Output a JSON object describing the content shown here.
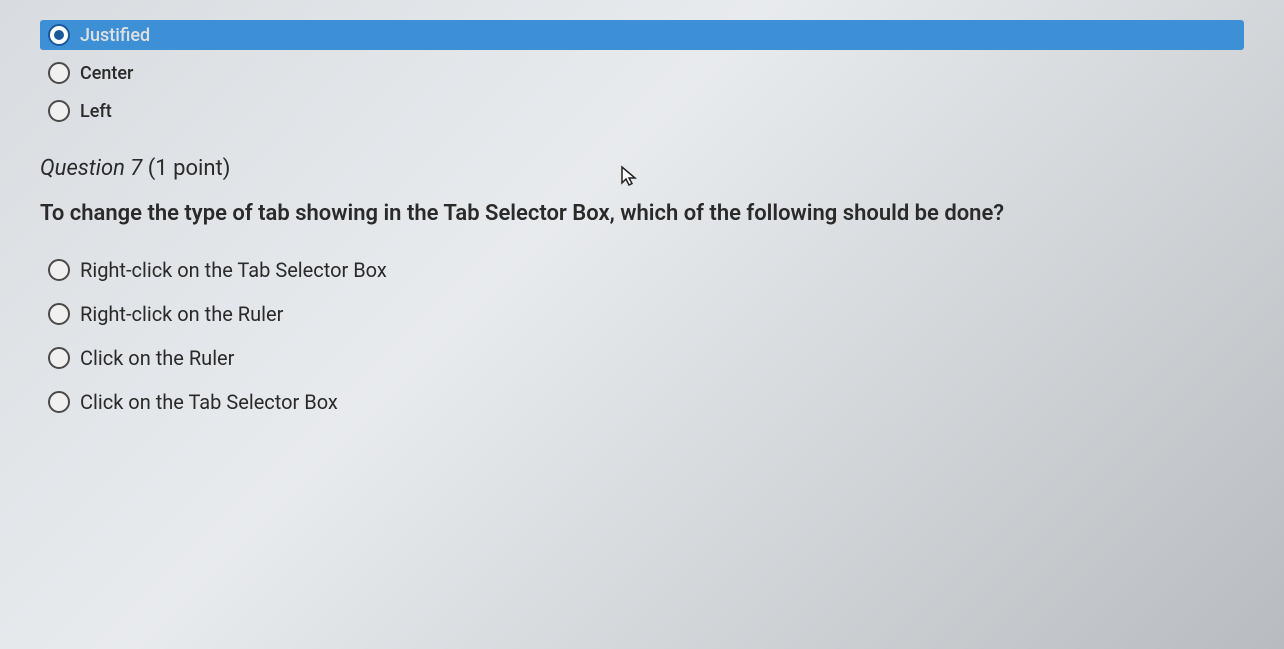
{
  "previous_question_options": [
    {
      "label": "Justified",
      "selected": true
    },
    {
      "label": "Center",
      "selected": false
    },
    {
      "label": "Left",
      "selected": false
    }
  ],
  "question": {
    "number": "Question 7",
    "points": "(1 point)",
    "prompt": "To change the type of tab showing in the Tab Selector Box, which of the following should be done?",
    "options": [
      {
        "label": "Right-click on the Tab Selector Box"
      },
      {
        "label": "Right-click on the Ruler"
      },
      {
        "label": "Click on the Ruler"
      },
      {
        "label": "Click on the Tab Selector Box"
      }
    ]
  }
}
